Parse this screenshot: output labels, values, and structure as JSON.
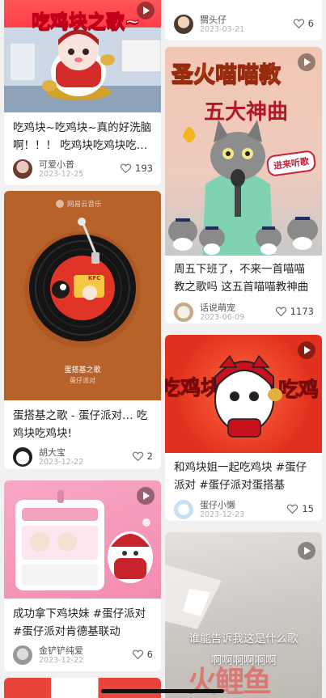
{
  "colors": {
    "accent_red": "#e8372c",
    "like_grey": "#888888",
    "date_grey": "#b0b0b0"
  },
  "feed": {
    "left": [
      {
        "cover_text": "吃鸡块之歌~",
        "has_play": true,
        "title": "吃鸡块~吃鸡块~真的好洗脑啊！！！ 吃鸡块吃鸡块吃鸡块",
        "author": "可爱小普",
        "date": "2023-12-25",
        "likes": "193"
      },
      {
        "cover_brand": "网易云音乐",
        "cover_song": "蛋搭基之歌",
        "cover_artist": "蛋仔派对",
        "cover_record_label": "KFC",
        "title": "蛋搭基之歌 - 蛋仔派对… 吃鸡块吃鸡块!",
        "author": "胡大宝",
        "date": "2023-12-22",
        "likes": "2"
      },
      {
        "has_play": true,
        "title": "成功拿下鸡块妹 #蛋仔派对 #蛋仔派对肯德基联动",
        "author": "金铲铲纯爱",
        "date": "2023-12-22",
        "likes": "6"
      }
    ],
    "right": [
      {
        "author": "猬头仔",
        "date": "2023-03-21",
        "likes": "6"
      },
      {
        "has_play": true,
        "cover_line1": "圣火喵喵教",
        "cover_line2": "五大神曲",
        "cover_badge": "进来听歌",
        "title": "周五下班了，不来一首喵喵教之歌吗 这五首喵喵教神曲",
        "author": "话说萌宠",
        "date": "2023-06-09",
        "likes": "1173"
      },
      {
        "has_play": true,
        "cover_left_text": "吃鸡块",
        "cover_right_text": "吃鸡",
        "title": "和鸡块姐一起吃鸡块 #蛋仔派对 #蛋仔派对蛋搭基",
        "author": "蛋仔小懒",
        "date": "2023-12-23",
        "likes": "15"
      },
      {
        "has_play": true,
        "cover_caption1": "谁能告诉我这是什么歌",
        "cover_caption2": "啊啊啊啊啊啊"
      }
    ]
  },
  "watermark": "火鲤鱼"
}
